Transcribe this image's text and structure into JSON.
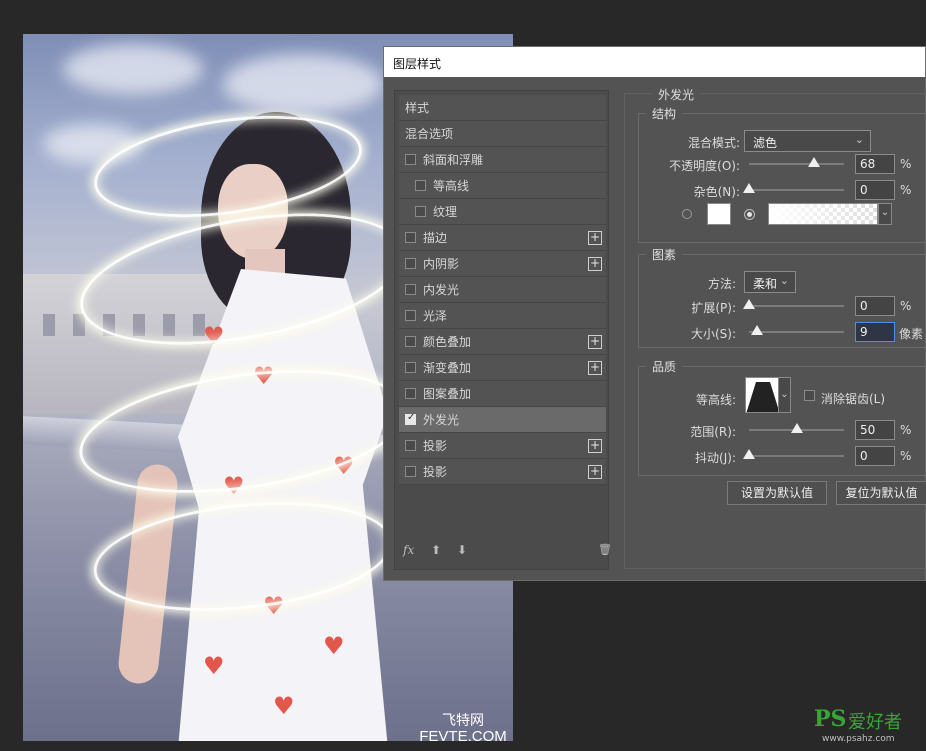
{
  "dialog": {
    "title": "图层样式"
  },
  "styles_list": {
    "items": [
      {
        "label": "样式",
        "checkbox": false,
        "plus": false,
        "indent": false,
        "selected": false
      },
      {
        "label": "混合选项",
        "checkbox": false,
        "plus": false,
        "indent": false,
        "selected": false
      },
      {
        "label": "斜面和浮雕",
        "checkbox": true,
        "checked": false,
        "plus": false,
        "indent": false,
        "selected": false
      },
      {
        "label": "等高线",
        "checkbox": true,
        "checked": false,
        "plus": false,
        "indent": true,
        "selected": false
      },
      {
        "label": "纹理",
        "checkbox": true,
        "checked": false,
        "plus": false,
        "indent": true,
        "selected": false
      },
      {
        "label": "描边",
        "checkbox": true,
        "checked": false,
        "plus": true,
        "indent": false,
        "selected": false
      },
      {
        "label": "内阴影",
        "checkbox": true,
        "checked": false,
        "plus": true,
        "indent": false,
        "selected": false
      },
      {
        "label": "内发光",
        "checkbox": true,
        "checked": false,
        "plus": false,
        "indent": false,
        "selected": false
      },
      {
        "label": "光泽",
        "checkbox": true,
        "checked": false,
        "plus": false,
        "indent": false,
        "selected": false
      },
      {
        "label": "颜色叠加",
        "checkbox": true,
        "checked": false,
        "plus": true,
        "indent": false,
        "selected": false
      },
      {
        "label": "渐变叠加",
        "checkbox": true,
        "checked": false,
        "plus": true,
        "indent": false,
        "selected": false
      },
      {
        "label": "图案叠加",
        "checkbox": true,
        "checked": false,
        "plus": false,
        "indent": false,
        "selected": false
      },
      {
        "label": "外发光",
        "checkbox": true,
        "checked": true,
        "plus": false,
        "indent": false,
        "selected": true
      },
      {
        "label": "投影",
        "checkbox": true,
        "checked": false,
        "plus": true,
        "indent": false,
        "selected": false
      },
      {
        "label": "投影",
        "checkbox": true,
        "checked": false,
        "plus": true,
        "indent": false,
        "selected": false
      }
    ],
    "bottom": {
      "fx": "fx",
      "up_arrow": "⬆",
      "down_arrow": "⬇",
      "trash": "🗑"
    }
  },
  "outer_glow": {
    "section_title": "外发光",
    "structure": {
      "legend": "结构",
      "blend_mode_label": "混合模式:",
      "blend_mode_value": "滤色",
      "opacity_label": "不透明度(O):",
      "opacity_value": "68",
      "opacity_percent": 0.68,
      "noise_label": "杂色(N):",
      "noise_value": "0",
      "noise_percent": 0,
      "percent": "%"
    },
    "elements": {
      "legend": "图素",
      "technique_label": "方法:",
      "technique_value": "柔和",
      "spread_label": "扩展(P):",
      "spread_value": "0",
      "spread_percent": 0,
      "size_label": "大小(S):",
      "size_value": "9",
      "size_unit": "像素",
      "percent": "%"
    },
    "quality": {
      "legend": "品质",
      "contour_label": "等高线:",
      "anti_alias_label": "消除锯齿(L)",
      "range_label": "范围(R):",
      "range_value": "50",
      "range_percent": 0.5,
      "jitter_label": "抖动(J):",
      "jitter_value": "0",
      "jitter_percent": 0,
      "percent": "%"
    },
    "buttons": {
      "make_default": "设置为默认值",
      "reset_default": "复位为默认值"
    }
  },
  "watermark": {
    "line1": "飞特网",
    "line2": "FEVTE.COM"
  },
  "corner_logo": {
    "brand": "PS",
    "text": "爱好者",
    "url": "www.psahz.com"
  },
  "colors": {
    "accent_focus": "#4b8de8",
    "heart": "#e2574c",
    "brand_green": "#33a02c"
  }
}
